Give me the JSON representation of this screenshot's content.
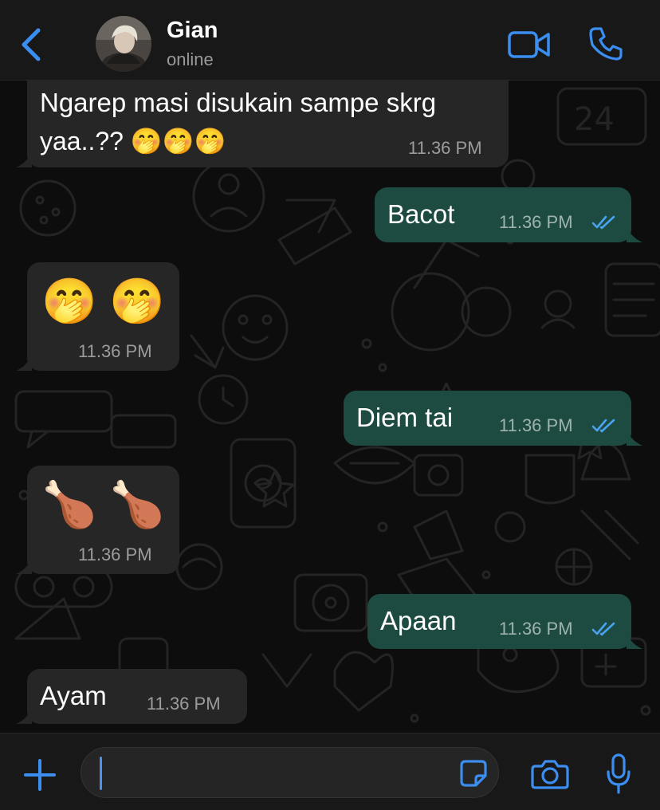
{
  "header": {
    "back_icon": "chevron-left-icon",
    "contact_name": "Gian",
    "status": "online",
    "video_icon": "video-camera-icon",
    "call_icon": "phone-icon",
    "accent_color": "#3b8ef0"
  },
  "messages": [
    {
      "direction": "in",
      "lines": [
        "Ngarep masi disukain sampe skrg",
        "yaa..?? 🤭🤭🤭"
      ],
      "time": "11.36 PM"
    },
    {
      "direction": "out",
      "text": "Bacot",
      "time": "11.36 PM",
      "status": "read"
    },
    {
      "direction": "in",
      "emoji": "🤭 🤭",
      "time": "11.36 PM"
    },
    {
      "direction": "out",
      "text": "Diem tai",
      "time": "11.36 PM",
      "status": "read"
    },
    {
      "direction": "in",
      "emoji": "🍗 🍗",
      "time": "11.36 PM"
    },
    {
      "direction": "out",
      "text": "Apaan",
      "time": "11.36 PM",
      "status": "read"
    },
    {
      "direction": "in",
      "text": "Ayam",
      "time": "11.36 PM"
    }
  ],
  "input_bar": {
    "plus_icon": "plus-icon",
    "value": "",
    "placeholder": "",
    "sticker_icon": "sticker-icon",
    "camera_icon": "camera-icon",
    "mic_icon": "microphone-icon"
  },
  "colors": {
    "incoming_bubble": "#262626",
    "outgoing_bubble": "#1d4b41",
    "read_ticks": "#4aa3f0"
  }
}
